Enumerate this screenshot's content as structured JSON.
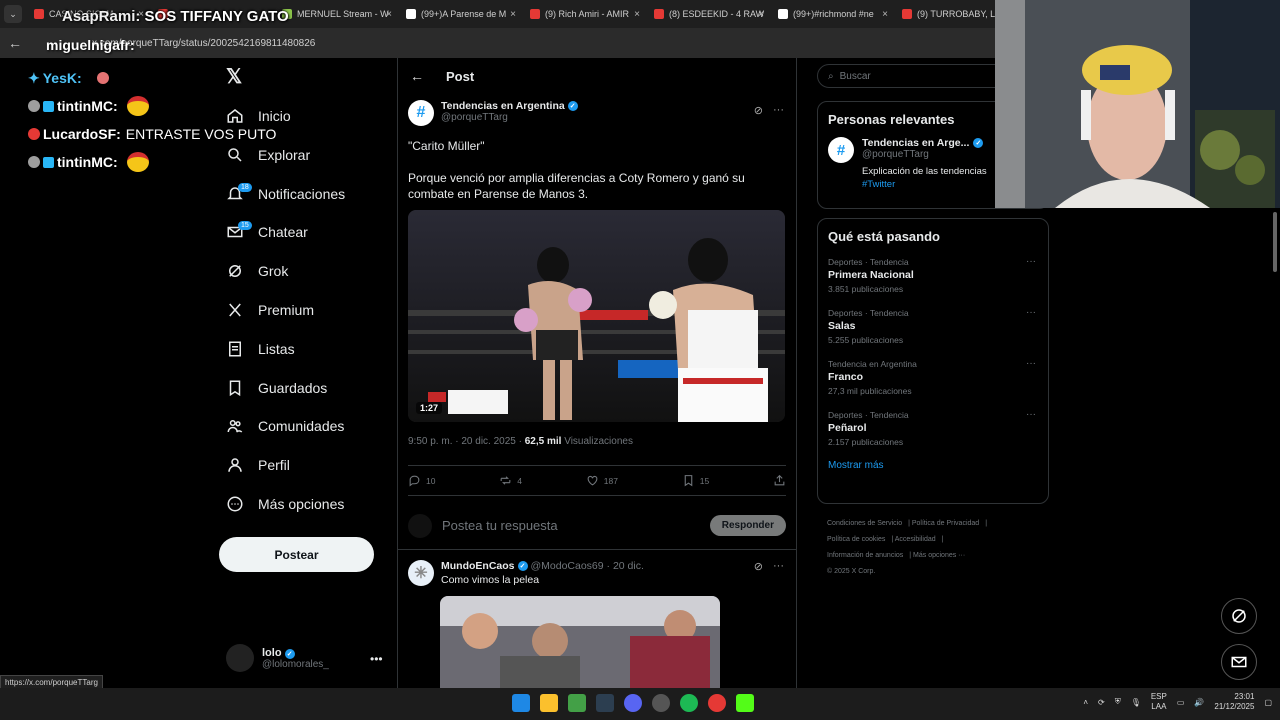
{
  "browser": {
    "tabs": [
      {
        "label": "CASINO SIGMA",
        "color": "#e53935"
      },
      {
        "label": "",
        "color": "#e53935"
      },
      {
        "label": "MERNUEL Stream - W",
        "color": "#8bc34a"
      },
      {
        "label": "(99+)A Parense de M",
        "color": "#ffffff"
      },
      {
        "label": "(9) Rich Amiri - AMIR",
        "color": "#e53935"
      },
      {
        "label": "(8) ESDEEKID - 4 RAW",
        "color": "#e53935"
      },
      {
        "label": "(99+)#richmond #ne",
        "color": "#ffffff"
      },
      {
        "label": "(9) TURROBABY, LITT",
        "color": "#e53935"
      }
    ],
    "url": "x.com/porqueTTarg/status/2002542169811480826",
    "status_url": "https://x.com/porqueTTarg"
  },
  "overlay": {
    "title_user": "AsapRami:",
    "title_msg": "SOS TIFFANY GATO",
    "user2": "miguelnigafr:"
  },
  "chat": [
    {
      "user": "YesK:",
      "message": "",
      "color": "#4fc3f7"
    },
    {
      "user": "tintinMC:",
      "message": "",
      "color": "#4fc3f7"
    },
    {
      "user": "LucardoSF:",
      "message": "ENTRASTE VOS PUTO",
      "color": "#4fc3f7"
    },
    {
      "user": "tintinMC:",
      "message": "",
      "color": "#4fc3f7"
    }
  ],
  "nav": {
    "items": [
      {
        "label": "Inicio",
        "icon": "home-icon"
      },
      {
        "label": "Explorar",
        "icon": "search-icon"
      },
      {
        "label": "Notificaciones",
        "icon": "bell-icon",
        "badge": "18"
      },
      {
        "label": "Chatear",
        "icon": "mail-icon",
        "badge": "15"
      },
      {
        "label": "Grok",
        "icon": "grok-icon"
      },
      {
        "label": "Premium",
        "icon": "x-icon"
      },
      {
        "label": "Listas",
        "icon": "list-icon"
      },
      {
        "label": "Guardados",
        "icon": "bookmark-icon"
      },
      {
        "label": "Comunidades",
        "icon": "people-icon"
      },
      {
        "label": "Perfil",
        "icon": "person-icon"
      },
      {
        "label": "Más opciones",
        "icon": "more-icon"
      }
    ],
    "post_button": "Postear",
    "profile_name": "lolo",
    "profile_handle": "@lolomorales_"
  },
  "main": {
    "header_title": "Post",
    "tweet": {
      "author": "Tendencias en Argentina",
      "handle": "@porqueTTarg",
      "title_line": "\"Carito Müller\"",
      "body": "Porque venció por amplia diferencias a Coty Romero y ganó su combate en Parense de Manos 3.",
      "video_duration": "1:27",
      "timestamp": "9:50 p. m. · 20 dic. 2025 ·",
      "views_count": "62,5 mil",
      "views_label": "Visualizaciones",
      "replies": "10",
      "reposts": "4",
      "likes": "187",
      "bookmarks": "15"
    },
    "reply_placeholder": "Postea tu respuesta",
    "reply_button": "Responder",
    "reply_tweet": {
      "author": "MundoEnCaos",
      "handle_date": "@ModoCaos69 · 20 dic.",
      "text": "Como vimos la pelea"
    }
  },
  "right": {
    "search_placeholder": "Buscar",
    "relevant_title": "Personas relevantes",
    "relevant": {
      "name": "Tendencias en Arge...",
      "handle": "@porqueTTarg",
      "bio": "Explicación de las tendencias",
      "bio_link": "#Twitter"
    },
    "trends_title": "Qué está pasando",
    "trends": [
      {
        "category": "Deportes · Tendencia",
        "name": "Primera Nacional",
        "count": "3.851 publicaciones"
      },
      {
        "category": "Deportes · Tendencia",
        "name": "Salas",
        "count": "5.255 publicaciones"
      },
      {
        "category": "Tendencia en Argentina",
        "name": "Franco",
        "count": "27,3 mil publicaciones"
      },
      {
        "category": "Deportes · Tendencia",
        "name": "Peñarol",
        "count": "2.157 publicaciones"
      }
    ],
    "show_more": "Mostrar más",
    "footer": {
      "terms": "Condiciones de Servicio",
      "privacy": "Política de Privacidad",
      "cookies": "Política de cookies",
      "access": "Accesibilidad",
      "ads": "Información de anuncios",
      "more": "Más opciones ···",
      "copy": "© 2025 X Corp."
    }
  },
  "taskbar": {
    "lang1": "ESP",
    "lang2": "LAA",
    "time": "23:01",
    "date": "21/12/2025"
  }
}
